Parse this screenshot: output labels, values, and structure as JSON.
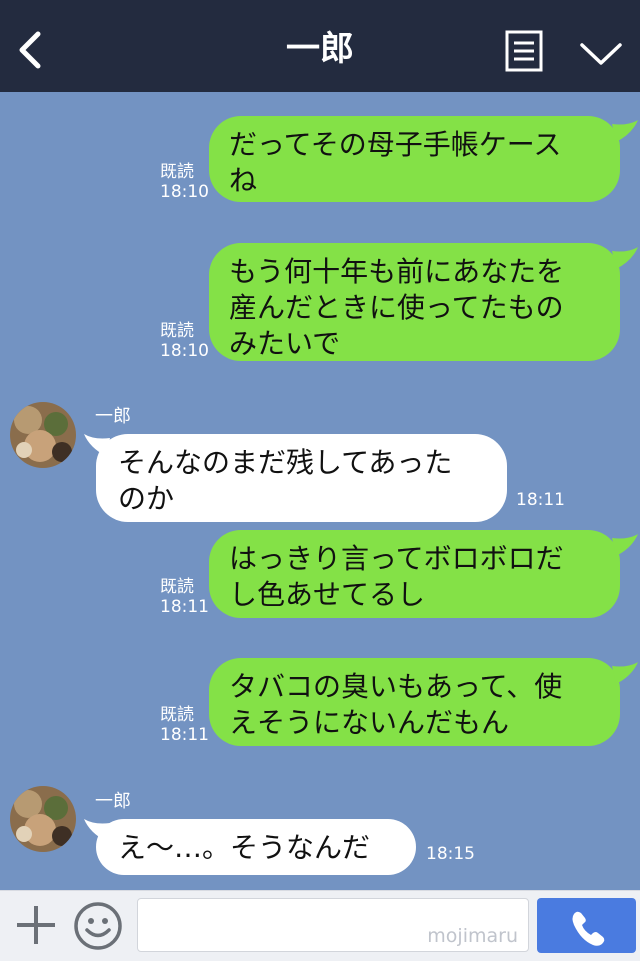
{
  "header": {
    "title": "一郎",
    "icons": {
      "back": "chevron-left-icon",
      "menu": "notes-icon",
      "expand": "chevron-down-icon"
    }
  },
  "messages": [
    {
      "side": "sent",
      "text": "だってその母子手帳ケース\nね",
      "read": "既読",
      "time": "18:10"
    },
    {
      "side": "sent",
      "text": "もう何十年も前にあなたを\n産んだときに使ってたもの\nみたいで",
      "read": "既読",
      "time": "18:10"
    },
    {
      "side": "received",
      "sender": "一郎",
      "text": "そんなのまだ残してあった\nのか",
      "time": "18:11"
    },
    {
      "side": "sent",
      "text": "はっきり言ってボロボロだ\nし色あせてるし",
      "read": "既読",
      "time": "18:11"
    },
    {
      "side": "sent",
      "text": "タバコの臭いもあって、使\nえそうにないんだもん",
      "read": "既読",
      "time": "18:11"
    },
    {
      "side": "received",
      "sender": "一郎",
      "text": "え〜…。そうなんだ",
      "time": "18:15"
    }
  ],
  "footer": {
    "input_value": "",
    "watermark": "mojimaru",
    "icons": {
      "plus": "plus-icon",
      "emoji": "emoji-icon",
      "call": "phone-icon"
    }
  },
  "colors": {
    "background": "#7393c2",
    "header": "#232b3f",
    "sent_bubble": "#84e147",
    "received_bubble": "#ffffff",
    "call_button": "#4a7be0"
  }
}
